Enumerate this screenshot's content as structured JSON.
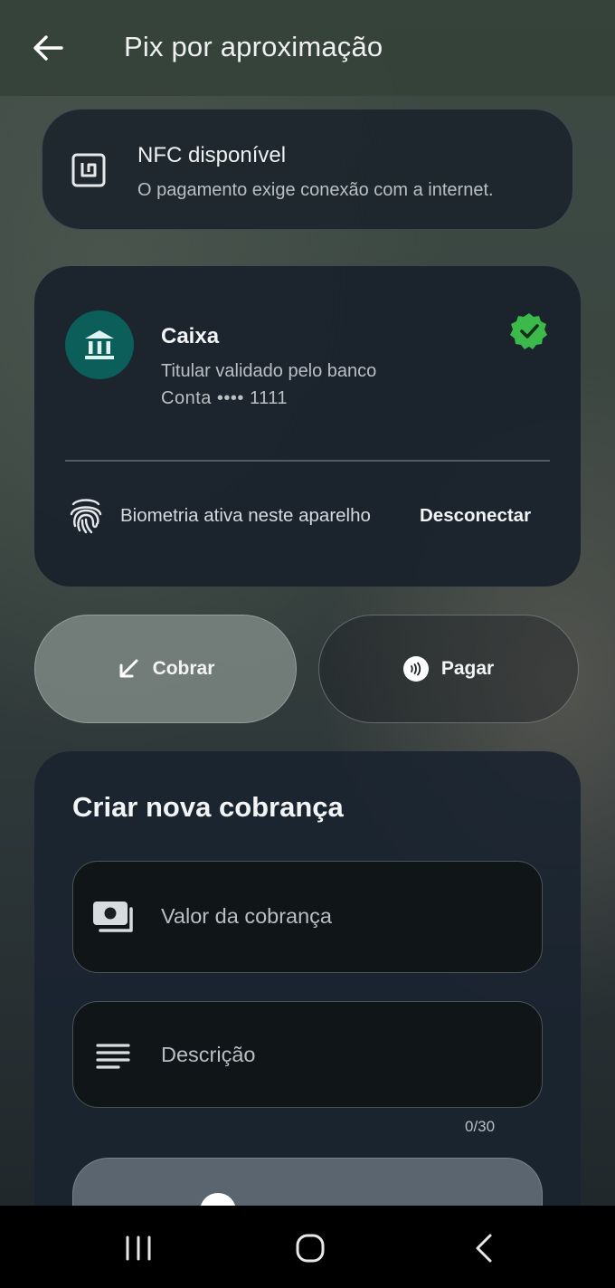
{
  "app_bar": {
    "title": "Pix por aproximação",
    "back_icon": "arrow-left-icon"
  },
  "nfc_card": {
    "icon": "nfc-icon",
    "title": "NFC disponível",
    "subtitle": "O pagamento exige conexão com a internet."
  },
  "bank_card": {
    "icon": "bank-icon",
    "bank_name": "Caixa",
    "holder_status": "Titular validado pelo banco",
    "account": "Conta •••• 1111",
    "verified_icon": "verified-badge-icon",
    "verified_color": "#3bb94a",
    "avatar_color": "#0b5e5a",
    "biometry_icon": "fingerprint-icon",
    "biometry_text": "Biometria ativa neste aparelho",
    "disconnect_label": "Desconectar"
  },
  "mode_selector": {
    "cobrar_label": "Cobrar",
    "cobrar_icon": "arrow-down-left-icon",
    "pagar_label": "Pagar",
    "pagar_icon": "contactless-icon",
    "selected": "Cobrar"
  },
  "form": {
    "title": "Criar nova cobrança",
    "valor_label": "Valor da cobrança",
    "valor_icon": "money-icon",
    "descricao_label": "Descrição",
    "descricao_icon": "text-lines-icon",
    "descricao_counter": "0/30"
  },
  "nav_bar": {
    "recents_icon": "recents-icon",
    "home_icon": "home-icon",
    "back_icon": "back-chevron-icon"
  }
}
